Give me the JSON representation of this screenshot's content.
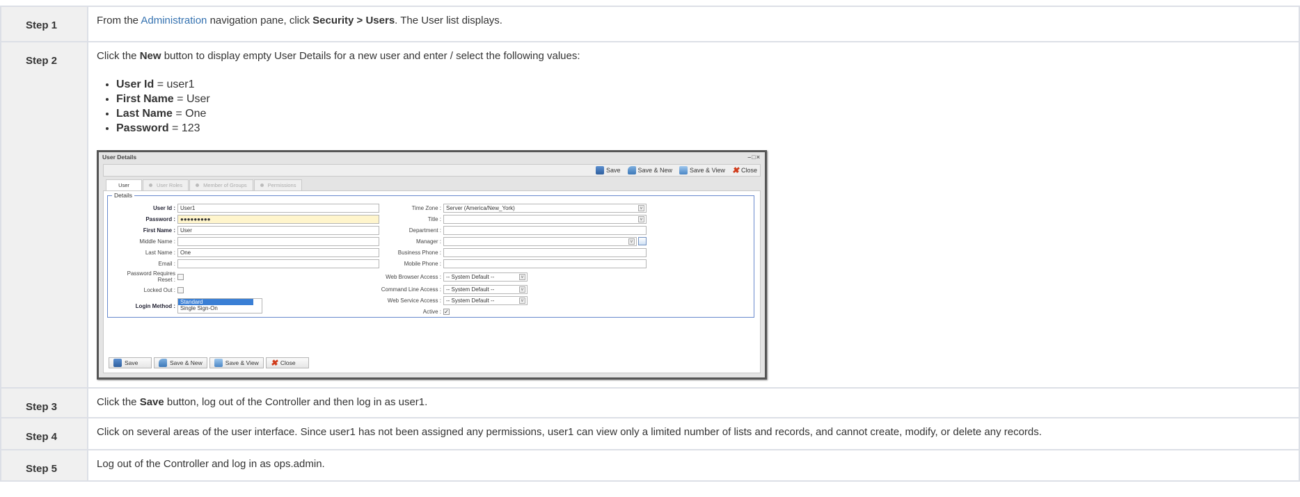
{
  "steps": [
    {
      "label": "Step 1"
    },
    {
      "label": "Step 2"
    },
    {
      "label": "Step 3"
    },
    {
      "label": "Step 4"
    },
    {
      "label": "Step 5"
    }
  ],
  "step1": {
    "pre": "From the ",
    "link": "Administration",
    "mid": " navigation pane, click ",
    "bold": "Security > Users",
    "post": ". The User list displays."
  },
  "step2": {
    "pre": "Click the ",
    "bold": "New",
    "post": " button to display empty User Details for a new user and enter / select the following values:",
    "values": [
      {
        "name": "User Id",
        "value": " = user1"
      },
      {
        "name": "First Name",
        "value": " = User"
      },
      {
        "name": "Last Name",
        "value": " = One"
      },
      {
        "name": "Password",
        "value": " = 123"
      }
    ]
  },
  "step3": {
    "pre": "Click the ",
    "bold": "Save",
    "post": " button, log out of the Controller and then log in as user1."
  },
  "step4": {
    "text": "Click on several areas of the user interface. Since user1 has not been assigned any permissions, user1 can view only a limited number of lists and records, and cannot create, modify, or delete any records."
  },
  "step5": {
    "text": "Log out of the Controller and log in as ops.admin."
  },
  "dialog": {
    "title": "User Details",
    "window_buttons": "–□×",
    "toolbar": {
      "save": "Save",
      "save_new": "Save & New",
      "save_view": "Save & View",
      "close": "Close"
    },
    "tabs": [
      "User",
      "User Roles",
      "Member of Groups",
      "Permissions"
    ],
    "legend": "Details",
    "left": {
      "user_id_label": "User Id :",
      "user_id": "User1",
      "password_label": "Password :",
      "password": "●●●●●●●●●",
      "first_name_label": "First Name :",
      "first_name": "User",
      "middle_name_label": "Middle Name :",
      "middle_name": "",
      "last_name_label": "Last Name :",
      "last_name": "One",
      "email_label": "Email :",
      "email": "",
      "pw_reset_label_1": "Password Requires",
      "pw_reset_label_2": "Reset :",
      "locked_out_label": "Locked Out :",
      "login_method_label": "Login Method :",
      "login_methods": [
        "Standard",
        "Single Sign-On"
      ]
    },
    "right": {
      "time_zone_label": "Time Zone :",
      "time_zone": "Server (America/New_York)",
      "title_label": "Title :",
      "title": "",
      "department_label": "Department :",
      "department": "",
      "manager_label": "Manager :",
      "manager": "",
      "business_phone_label": "Business Phone :",
      "business_phone": "",
      "mobile_phone_label": "Mobile Phone :",
      "mobile_phone": "",
      "web_browser_label": "Web Browser Access :",
      "web_browser": "-- System Default --",
      "command_line_label": "Command Line Access :",
      "command_line": "-- System Default --",
      "web_service_label": "Web Service Access :",
      "web_service": "-- System Default --",
      "active_label": "Active :",
      "active_check": "✓"
    },
    "bottom": {
      "save": "Save",
      "save_new": "Save & New",
      "save_view": "Save & View",
      "close": "Close"
    }
  },
  "colors": {
    "link": "#3572b0",
    "step_bg": "#f0f0f0",
    "border": "#dcdfe6"
  }
}
